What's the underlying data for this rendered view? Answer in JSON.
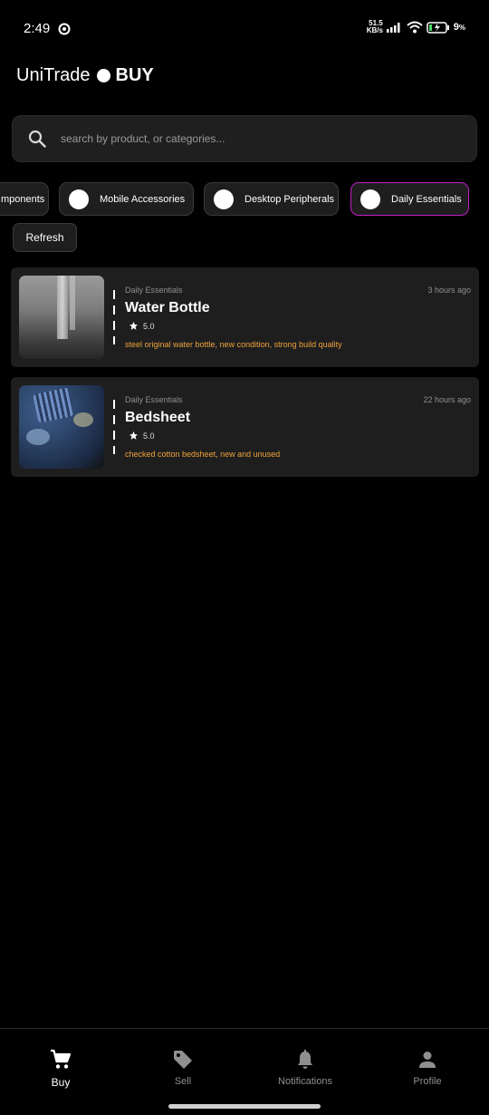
{
  "status_bar": {
    "time": "2:49",
    "net_speed_value": "51.5",
    "net_speed_unit": "KB/s",
    "battery_percent": "9",
    "battery_unit": "%"
  },
  "header": {
    "app_name": "UniTrade",
    "mode": "BUY"
  },
  "search": {
    "placeholder": "search by product, or categories...",
    "value": ""
  },
  "categories": [
    {
      "label": "mponents",
      "selected": false
    },
    {
      "label": "Mobile Accessories",
      "selected": false
    },
    {
      "label": "Desktop Peripherals",
      "selected": false
    },
    {
      "label": "Daily Essentials",
      "selected": true
    }
  ],
  "refresh_label": "Refresh",
  "products": [
    {
      "category": "Daily Essentials",
      "time": "3 hours ago",
      "title": "Water Bottle",
      "rating": "5.0",
      "description": "steel original water bottle, new condition, strong build quality"
    },
    {
      "category": "Daily Essentials",
      "time": "22 hours ago",
      "title": "Bedsheet",
      "rating": "5.0",
      "description": "checked cotton bedsheet, new and unused"
    }
  ],
  "nav": {
    "buy": "Buy",
    "sell": "Sell",
    "notifications": "Notifications",
    "profile": "Profile"
  },
  "colors": {
    "background": "#000000",
    "card": "#1e1e1e",
    "accent_selected": "#c21fc4",
    "description": "#f0a33c"
  },
  "icons": [
    "sync-icon",
    "signal-icon",
    "wifi-icon",
    "battery-icon",
    "search-icon",
    "star-icon",
    "cart-icon",
    "tag-icon",
    "bell-icon",
    "person-icon"
  ]
}
